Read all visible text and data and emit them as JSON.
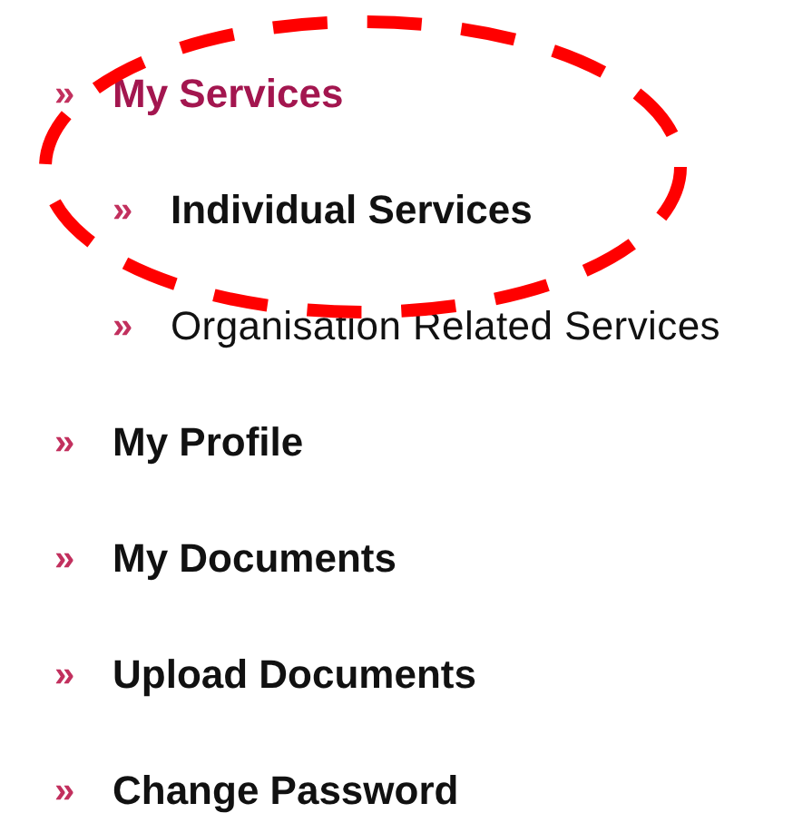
{
  "menu": [
    {
      "marker": "»",
      "label": "My Services",
      "selected": true,
      "children": [
        {
          "marker": "»",
          "label": "Individual Services",
          "selected": true
        },
        {
          "marker": "»",
          "label": "Organisation Related Services",
          "selected": false
        }
      ]
    },
    {
      "marker": "»",
      "label": "My Profile",
      "selected": false
    },
    {
      "marker": "»",
      "label": "My Documents",
      "selected": false
    },
    {
      "marker": "»",
      "label": "Upload Documents",
      "selected": false
    },
    {
      "marker": "»",
      "label": "Change Password",
      "selected": false
    }
  ]
}
